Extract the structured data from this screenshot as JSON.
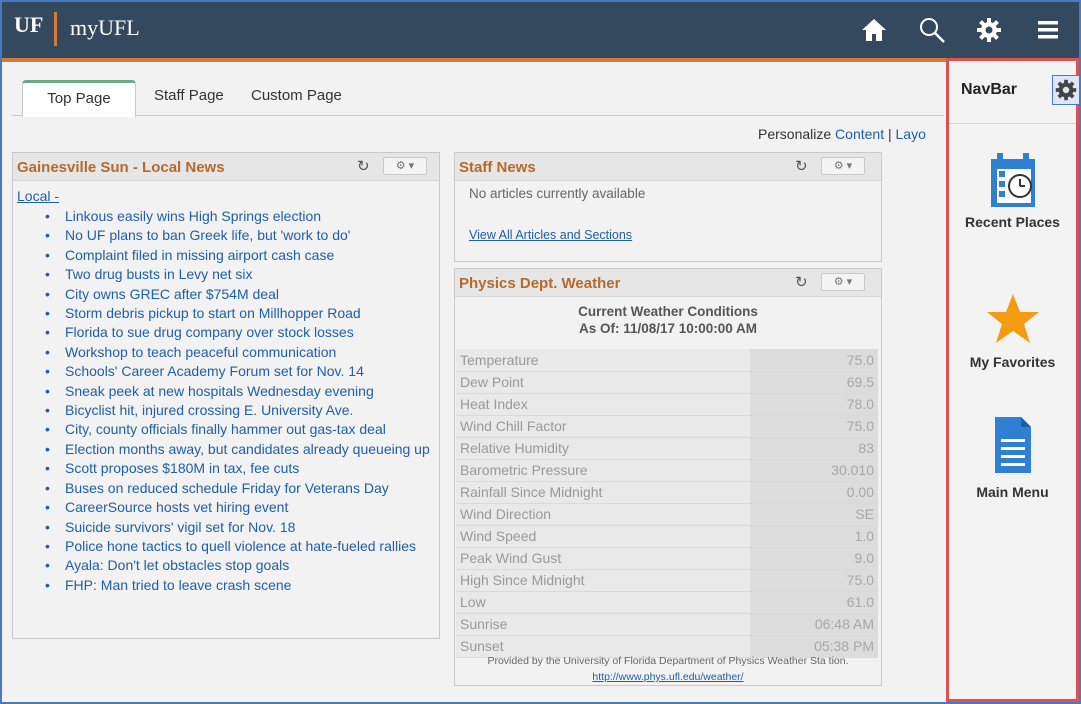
{
  "header": {
    "logo_text": "UF",
    "app_title": "myUFL",
    "icons": [
      "home-icon",
      "search-icon",
      "gear-icon",
      "hamburger-menu-icon"
    ],
    "colors": {
      "bar": "#34495e",
      "accent": "#d67a3a"
    }
  },
  "tabs": {
    "active": "Top Page",
    "items": [
      "Staff Page",
      "Custom Page"
    ]
  },
  "personalize": {
    "prefix": "Personalize",
    "content_link": "Content",
    "separator": "|",
    "layout_link": "Layo"
  },
  "news_pagelet": {
    "title": "Gainesville Sun - Local News",
    "section": "Local -",
    "items": [
      "Linkous easily wins High Springs election",
      "No UF plans to ban Greek life, but 'work to do'",
      "Complaint filed in missing airport cash case",
      "Two drug busts in Levy net six",
      "City owns GREC after $754M deal",
      "Storm debris pickup to start on Millhopper Road",
      "Florida to sue drug company over stock losses",
      "Workshop to teach peaceful communication",
      "Schools' Career Academy Forum set for Nov. 14",
      "Sneak peek at new hospitals Wednesday evening",
      "Bicyclist hit, injured crossing E. University Ave.",
      "City, county officials finally hammer out gas-tax deal",
      "Election months away, but candidates already queueing up",
      "Scott proposes $180M in tax, fee cuts",
      "Buses on reduced schedule Friday for Veterans Day",
      "CareerSource hosts vet hiring event",
      "Suicide survivors' vigil set for Nov. 18",
      "Police hone tactics to quell violence at hate-fueled rallies",
      "Ayala: Don't let obstacles stop goals",
      "FHP: Man tried to leave crash scene"
    ]
  },
  "staff_news": {
    "title": "Staff News",
    "message": "No articles currently available",
    "link": "View All Articles and Sections"
  },
  "weather": {
    "title": "Physics Dept. Weather",
    "heading1": "Current Weather Conditions",
    "heading2": "As Of: 11/08/17 10:00:00 AM",
    "rows": [
      {
        "label": "Temperature",
        "value": "75.0"
      },
      {
        "label": "Dew Point",
        "value": "69.5"
      },
      {
        "label": "Heat Index",
        "value": "78.0"
      },
      {
        "label": "Wind Chill Factor",
        "value": "75.0"
      },
      {
        "label": "Relative Humidity",
        "value": "83"
      },
      {
        "label": "Barometric Pressure",
        "value": "30.010"
      },
      {
        "label": "Rainfall Since Midnight",
        "value": "0.00"
      },
      {
        "label": "Wind Direction",
        "value": "SE"
      },
      {
        "label": "Wind Speed",
        "value": "1.0"
      },
      {
        "label": "Peak Wind Gust",
        "value": "9.0"
      },
      {
        "label": "High Since Midnight",
        "value": "75.0"
      },
      {
        "label": "Low",
        "value": "61.0"
      },
      {
        "label": "Sunrise",
        "value": "06:48 AM"
      },
      {
        "label": "Sunset",
        "value": "05:38 PM"
      }
    ],
    "footer_text": "Provided by the University of Florida Department of Physics Weather Sta tion.",
    "footer_link": "http://www.phys.ufl.edu/weather/"
  },
  "navbar": {
    "title": "NavBar",
    "items": [
      {
        "label": "Recent Places",
        "icon": "calendar-clock-icon"
      },
      {
        "label": "My Favorites",
        "icon": "star-icon"
      },
      {
        "label": "Main Menu",
        "icon": "document-icon"
      }
    ],
    "colors": {
      "border": "#d9534f",
      "icon_blue": "#2f80d3",
      "star": "#f39c12"
    }
  }
}
